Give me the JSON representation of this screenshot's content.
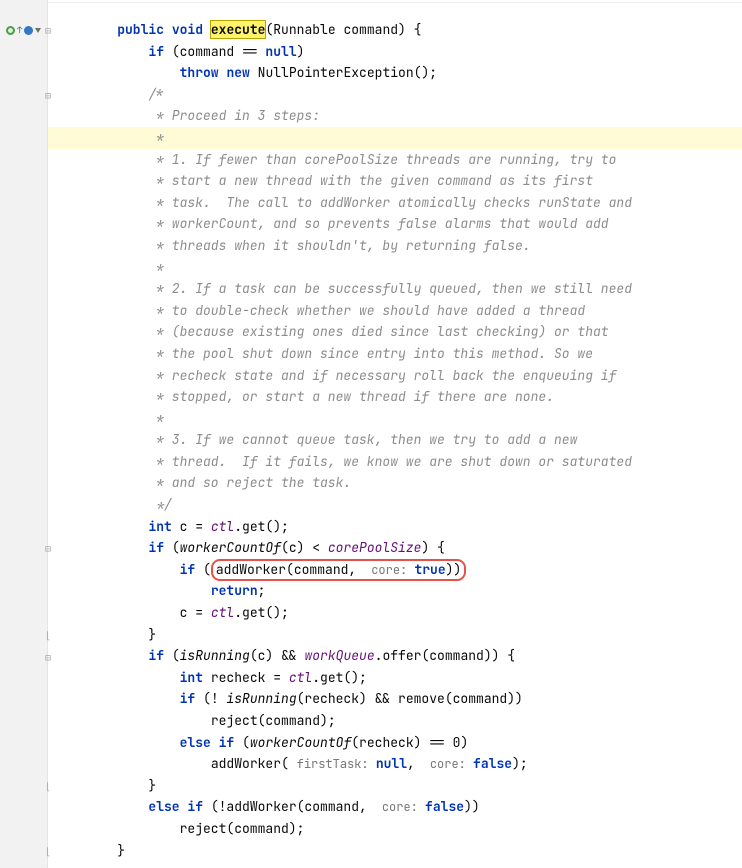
{
  "gutter": {
    "icons": [
      "implements",
      "override",
      "arrow"
    ]
  },
  "code": {
    "l1": {
      "indent": "    ",
      "kw1": "public",
      "kw2": "void",
      "method": "execute",
      "sig_after": "(Runnable command) {"
    },
    "l2": {
      "indent": "        ",
      "kw": "if",
      "expr_pre": " (command == ",
      "kw2": "null",
      "expr_post": ")"
    },
    "l3": {
      "indent": "            ",
      "kw1": "throw",
      "kw2": "new",
      "call": " NullPointerException();"
    },
    "l4": {
      "indent": "        ",
      "txt": "/*"
    },
    "l5": {
      "indent": "         ",
      "txt": "* Proceed in 3 steps:"
    },
    "l6": {
      "indent": "         ",
      "txt": "*"
    },
    "l7": {
      "indent": "         ",
      "txt": "* 1. If fewer than corePoolSize threads are running, try to"
    },
    "l8": {
      "indent": "         ",
      "txt": "* start a new thread with the given command as its first"
    },
    "l9": {
      "indent": "         ",
      "txt": "* task.  The call to addWorker atomically checks runState and"
    },
    "l10": {
      "indent": "         ",
      "txt": "* workerCount, and so prevents false alarms that would add"
    },
    "l11": {
      "indent": "         ",
      "txt": "* threads when it shouldn't, by returning false."
    },
    "l12": {
      "indent": "         ",
      "txt": "*"
    },
    "l13": {
      "indent": "         ",
      "txt": "* 2. If a task can be successfully queued, then we still need"
    },
    "l14": {
      "indent": "         ",
      "txt": "* to double-check whether we should have added a thread"
    },
    "l15": {
      "indent": "         ",
      "txt": "* (because existing ones died since last checking) or that"
    },
    "l16": {
      "indent": "         ",
      "txt": "* the pool shut down since entry into this method. So we"
    },
    "l17": {
      "indent": "         ",
      "txt": "* recheck state and if necessary roll back the enqueuing if"
    },
    "l18": {
      "indent": "         ",
      "txt": "* stopped, or start a new thread if there are none."
    },
    "l19": {
      "indent": "         ",
      "txt": "*"
    },
    "l20": {
      "indent": "         ",
      "txt": "* 3. If we cannot queue task, then we try to add a new"
    },
    "l21": {
      "indent": "         ",
      "txt": "* thread.  If it fails, we know we are shut down or saturated"
    },
    "l22": {
      "indent": "         ",
      "txt": "* and so reject the task."
    },
    "l23": {
      "indent": "         ",
      "txt": "*/"
    },
    "l24": {
      "indent": "        ",
      "kw": "int",
      "pre": " c = ",
      "field": "ctl",
      "post": ".get();"
    },
    "l25": {
      "indent": "        ",
      "kw": "if",
      "pre": " (",
      "m1": "workerCountOf",
      "mid": "(c) < ",
      "field": "corePoolSize",
      "post": ") {"
    },
    "l26": {
      "indent": "            ",
      "kw": "if",
      "pre": " (",
      "call": "addWorker(command, ",
      "hint": " core: ",
      "kw2": "true",
      "post": "))"
    },
    "l27": {
      "indent": "                ",
      "kw": "return",
      "post": ";"
    },
    "l28": {
      "indent": "            ",
      "pre": "c = ",
      "field": "ctl",
      "post": ".get();"
    },
    "l29": {
      "indent": "        ",
      "txt": "}"
    },
    "l30": {
      "indent": "        ",
      "kw": "if",
      "pre": " (",
      "m1": "isRunning",
      "mid1": "(c) && ",
      "field": "workQueue",
      "mid2": ".offer(command)) {"
    },
    "l31": {
      "indent": "            ",
      "kw": "int",
      "pre": " recheck = ",
      "field": "ctl",
      "post": ".get();"
    },
    "l32": {
      "indent": "            ",
      "kw": "if",
      "pre": " (! ",
      "m1": "isRunning",
      "post": "(recheck) && remove(command))"
    },
    "l33": {
      "indent": "                ",
      "txt": "reject(command);"
    },
    "l34": {
      "indent": "            ",
      "kw1": "else",
      "kw2": "if",
      "pre": " (",
      "m1": "workerCountOf",
      "post": "(recheck) == 0)"
    },
    "l35": {
      "indent": "                ",
      "pre": "addWorker( ",
      "hint1": "firstTask: ",
      "kw1": "null",
      "mid": ", ",
      "hint2": " core: ",
      "kw2": "false",
      "post": ");"
    },
    "l36": {
      "indent": "        ",
      "txt": "}"
    },
    "l37": {
      "indent": "        ",
      "kw1": "else",
      "kw2": "if",
      "pre": " (!addWorker(command, ",
      "hint": " core: ",
      "kw3": "false",
      "post": "))"
    },
    "l38": {
      "indent": "            ",
      "txt": "reject(command);"
    },
    "l39": {
      "indent": "    ",
      "txt": "}"
    }
  }
}
